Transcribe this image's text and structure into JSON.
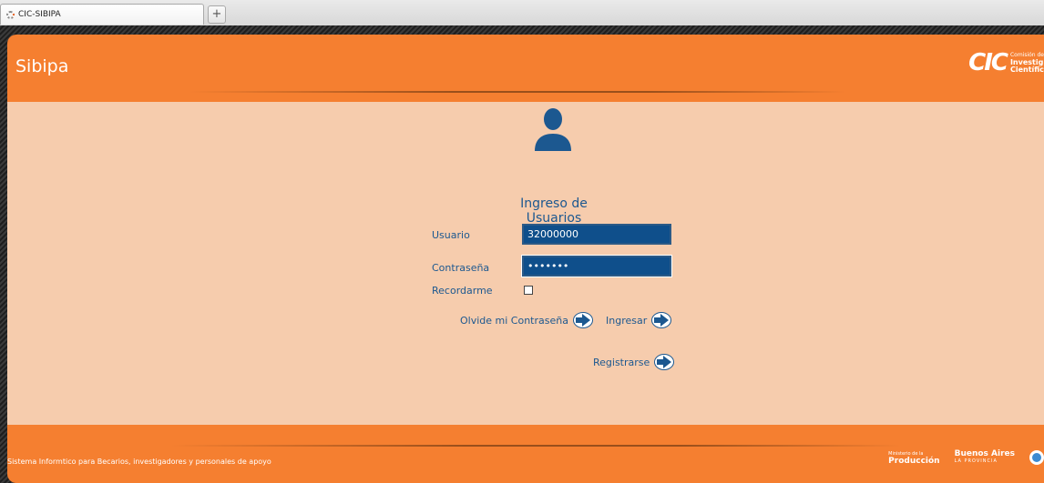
{
  "browser": {
    "tab_title": "CIC-SIBIPA",
    "new_tab_label": "+"
  },
  "header": {
    "title": "Sibipa",
    "logo_mark": "CIC",
    "logo_line1": "Comisión de",
    "logo_line2": "Investig",
    "logo_line3": "Científic"
  },
  "login": {
    "title": "Ingreso de Usuarios",
    "usuario_label": "Usuario",
    "usuario_value": "32000000",
    "contrasena_label": "Contraseña",
    "contrasena_value": "•••••••",
    "recordarme_label": "Recordarme",
    "olvide_label": "Olvide mi Contraseña",
    "ingresar_label": "Ingresar",
    "registrarse_label": "Registrarse"
  },
  "footer": {
    "text": "Sistema Informtico para Becarios, investigadores y personales de apoyo",
    "produccion_small": "Ministerio de la",
    "produccion": "Producción",
    "buenos_aires": "Buenos Aires",
    "la_provincia": "LA PROVINCIA"
  },
  "colors": {
    "orange": "#f57f30",
    "peach": "#f6ccad",
    "blue": "#1c5890"
  }
}
